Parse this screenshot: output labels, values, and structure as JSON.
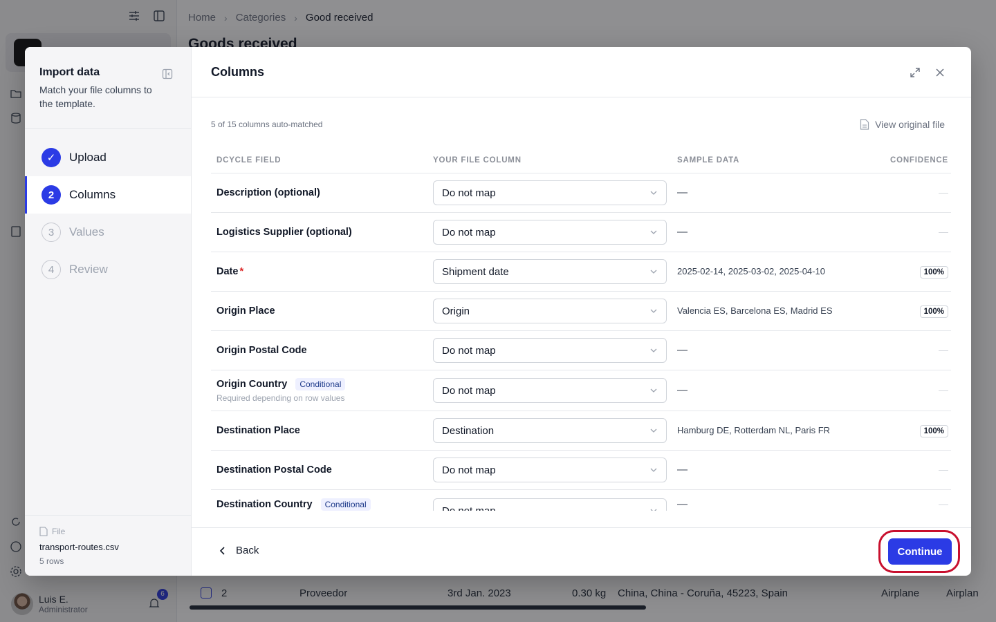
{
  "breadcrumb": {
    "home": "Home",
    "categories": "Categories",
    "current": "Good received"
  },
  "page_title": "Goods received",
  "user": {
    "name": "Luis E.",
    "role": "Administrator",
    "notifications": "6"
  },
  "bg_row": {
    "index": "2",
    "supplier": "Proveedor",
    "date": "3rd Jan. 2023",
    "weight": "0.30 kg",
    "route": "China, China - Coruña, 45223, Spain",
    "mode": "Airplane",
    "mode2": "Airplan"
  },
  "sidebar": {
    "title": "Import data",
    "subtitle": "Match your file columns to the template.",
    "steps": [
      {
        "num": "✓",
        "label": "Upload"
      },
      {
        "num": "2",
        "label": "Columns"
      },
      {
        "num": "3",
        "label": "Values"
      },
      {
        "num": "4",
        "label": "Review"
      }
    ],
    "file": {
      "label": "File",
      "name": "transport-routes.csv",
      "rows": "5 rows"
    }
  },
  "content": {
    "title": "Columns",
    "summary": "5 of 15 columns auto-matched",
    "view_file": "View original file",
    "headers": [
      "DCYCLE FIELD",
      "YOUR FILE COLUMN",
      "SAMPLE DATA",
      "CONFIDENCE"
    ],
    "rows": [
      {
        "field": "Description (optional)",
        "mapping": "Do not map",
        "sample": "—",
        "confidence": "—"
      },
      {
        "field": "Logistics Supplier (optional)",
        "mapping": "Do not map",
        "sample": "—",
        "confidence": "—"
      },
      {
        "field": "Date",
        "required": "*",
        "mapping": "Shipment date",
        "sample": "2025-02-14, 2025-03-02, 2025-04-10",
        "confidence": "100%"
      },
      {
        "field": "Origin Place",
        "mapping": "Origin",
        "sample": "Valencia ES, Barcelona ES, Madrid ES",
        "confidence": "100%"
      },
      {
        "field": "Origin Postal Code",
        "mapping": "Do not map",
        "sample": "—",
        "confidence": "—"
      },
      {
        "field": "Origin Country",
        "tag": "Conditional",
        "hint": "Required depending on row values",
        "mapping": "Do not map",
        "sample": "—",
        "confidence": "—"
      },
      {
        "field": "Destination Place",
        "mapping": "Destination",
        "sample": "Hamburg DE, Rotterdam NL, Paris FR",
        "confidence": "100%"
      },
      {
        "field": "Destination Postal Code",
        "mapping": "Do not map",
        "sample": "—",
        "confidence": "—"
      },
      {
        "field": "Destination Country",
        "tag": "Conditional",
        "mapping": "Do not map",
        "sample": "—",
        "confidence": "—"
      }
    ],
    "back": "Back",
    "continue": "Continue"
  },
  "colors": {
    "accent": "#2b3be5",
    "highlight": "#c8102e",
    "required": "#dc2626"
  }
}
